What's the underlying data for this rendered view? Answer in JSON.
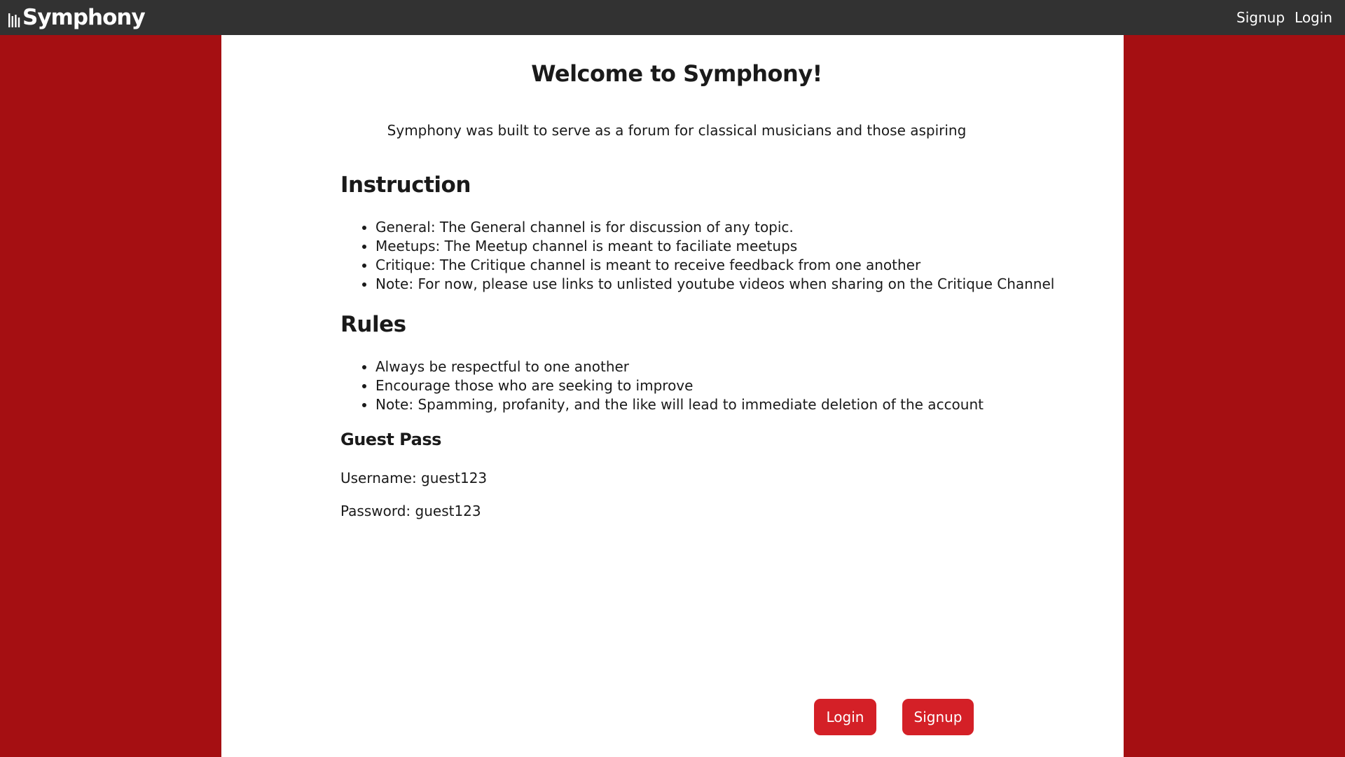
{
  "navbar": {
    "brand": "Symphony",
    "brand_icon": "music-bars-icon",
    "links": [
      "Signup",
      "Login"
    ]
  },
  "main": {
    "title": "Welcome to Symphony!",
    "intro": "Symphony was built to serve as a forum for classical musicians and those aspiring",
    "instruction": {
      "title": "Instruction",
      "items": [
        "General: The General channel is for discussion of any topic.",
        "Meetups: The Meetup channel is meant to faciliate meetups",
        "Critique: The Critique channel is meant to receive feedback from one another",
        "Note: For now, please use links to unlisted youtube videos when sharing on the Critique Channel"
      ]
    },
    "rules": {
      "title": "Rules",
      "items": [
        "Always be respectful to one another",
        "Encourage those who are seeking to improve",
        "Note: Spamming, profanity, and the like will lead to immediate deletion of the account"
      ]
    },
    "guest_pass": {
      "title": "Guest Pass",
      "username": "Username: guest123",
      "password": "Password: guest123"
    },
    "buttons": {
      "login": "Login",
      "signup": "Signup"
    }
  },
  "colors": {
    "background": "#a50f12",
    "navbar": "#323232",
    "content": "#ffffff",
    "button": "#d42027"
  }
}
